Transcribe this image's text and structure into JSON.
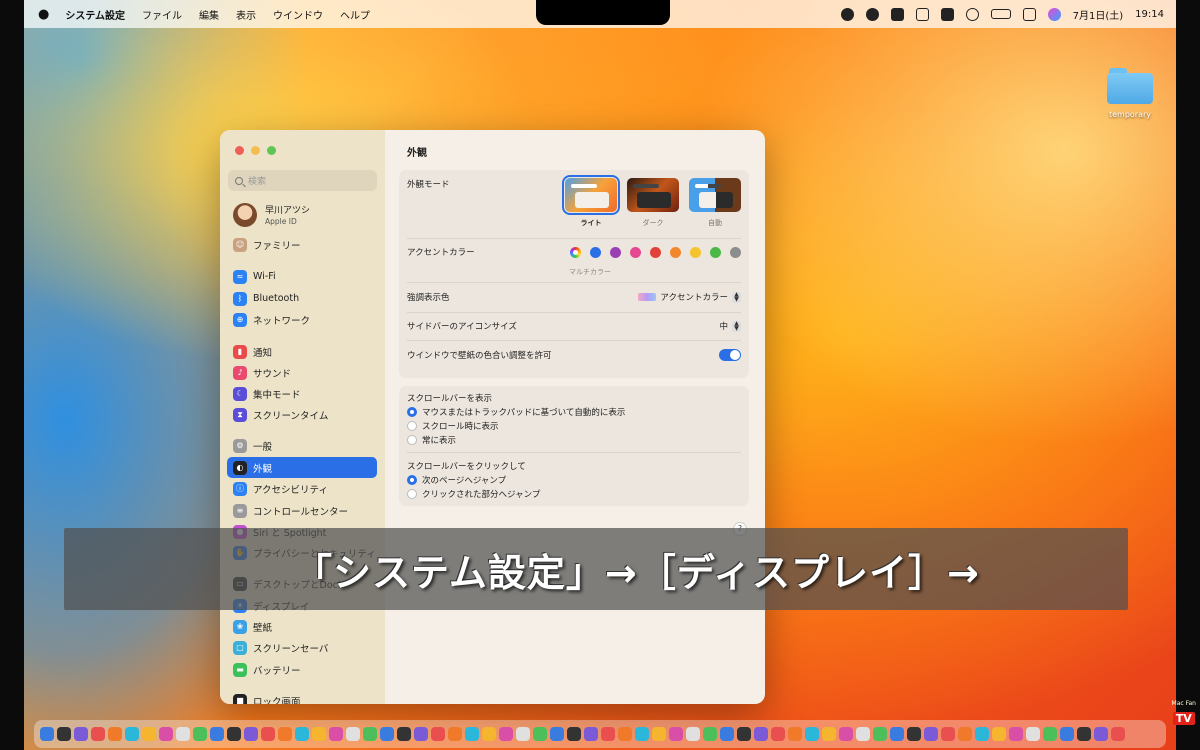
{
  "menubar": {
    "apple": "",
    "app_name": "システム設定",
    "menus": [
      "ファイル",
      "編集",
      "表示",
      "ウインドウ",
      "ヘルプ"
    ],
    "status_icons": [
      "record-icon",
      "cloud-icon",
      "dropbox-icon",
      "app-icon",
      "display-icon",
      "search-icon",
      "battery-icon",
      "control-center-icon",
      "siri-icon"
    ],
    "date": "7月1日(土)",
    "time": "19:14"
  },
  "desktop": {
    "folder_label": "temporary"
  },
  "sidebar": {
    "search_placeholder": "検索",
    "profile": {
      "name": "早川アツシ",
      "sub": "Apple ID"
    },
    "items": [
      {
        "label": "ファミリー",
        "icon": "family-icon",
        "color": "#c9a080"
      },
      {
        "label": "Wi-Fi",
        "icon": "wifi-icon",
        "color": "#2a82f5"
      },
      {
        "label": "Bluetooth",
        "icon": "bluetooth-icon",
        "color": "#2a82f5"
      },
      {
        "label": "ネットワーク",
        "icon": "globe-icon",
        "color": "#2a82f5"
      },
      {
        "label": "通知",
        "icon": "bell-icon",
        "color": "#ea4a4a"
      },
      {
        "label": "サウンド",
        "icon": "speaker-icon",
        "color": "#ea4a6e"
      },
      {
        "label": "集中モード",
        "icon": "moon-icon",
        "color": "#5a4ed8"
      },
      {
        "label": "スクリーンタイム",
        "icon": "hourglass-icon",
        "color": "#5a4ed8"
      },
      {
        "label": "一般",
        "icon": "gear-icon",
        "color": "#9a9a9a"
      },
      {
        "label": "外観",
        "icon": "appearance-icon",
        "color": "#222222"
      },
      {
        "label": "アクセシビリティ",
        "icon": "accessibility-icon",
        "color": "#2a82f5"
      },
      {
        "label": "コントロールセンター",
        "icon": "control-center-icon",
        "color": "#9a9a9a"
      },
      {
        "label": "Siri と Spotlight",
        "icon": "siri-icon",
        "color": "#c050d0"
      },
      {
        "label": "プライバシーとセキュリティ",
        "icon": "hand-icon",
        "color": "#2a82f5"
      },
      {
        "label": "デスクトップとDock",
        "icon": "dock-icon",
        "color": "#333333"
      },
      {
        "label": "ディスプレイ",
        "icon": "display-icon",
        "color": "#2a82f5"
      },
      {
        "label": "壁紙",
        "icon": "wallpaper-icon",
        "color": "#3aa0e8"
      },
      {
        "label": "スクリーンセーバ",
        "icon": "screensaver-icon",
        "color": "#3ab0d8"
      },
      {
        "label": "バッテリー",
        "icon": "battery-icon",
        "color": "#3cc05a"
      },
      {
        "label": "ロック画面",
        "icon": "lock-icon",
        "color": "#222222"
      }
    ],
    "selected": "外観"
  },
  "main": {
    "title": "外観",
    "appearance_mode": {
      "label": "外観モード",
      "options": [
        "ライト",
        "ダーク",
        "自動"
      ],
      "selected": "ライト"
    },
    "accent": {
      "label": "アクセントカラー",
      "selected_caption": "マルチカラー",
      "colors": [
        "multi",
        "#2a6fe5",
        "#9b3fb5",
        "#e54790",
        "#e2403a",
        "#f2872c",
        "#f5c32c",
        "#4cb848",
        "#8d8d8d"
      ]
    },
    "highlight": {
      "label": "強調表示色",
      "value": "アクセントカラー"
    },
    "sidebar_icon_size": {
      "label": "サイドバーのアイコンサイズ",
      "value": "中"
    },
    "wallpaper_tint": {
      "label": "ウインドウで壁紙の色合い調整を許可",
      "on": true
    },
    "scrollbars": {
      "label": "スクロールバーを表示",
      "options": [
        "マウスまたはトラックパッドに基づいて自動的に表示",
        "スクロール時に表示",
        "常に表示"
      ],
      "selected_index": 0
    },
    "click_scrollbar": {
      "label": "スクロールバーをクリックして",
      "options": [
        "次のページへジャンプ",
        "クリックされた部分へジャンプ"
      ],
      "selected_index": 0
    },
    "help": "?"
  },
  "caption": "「システム設定」→［ディスプレイ］→",
  "branding": {
    "top": "Mac Fan",
    "tv": "TV"
  },
  "dock_count": 64
}
